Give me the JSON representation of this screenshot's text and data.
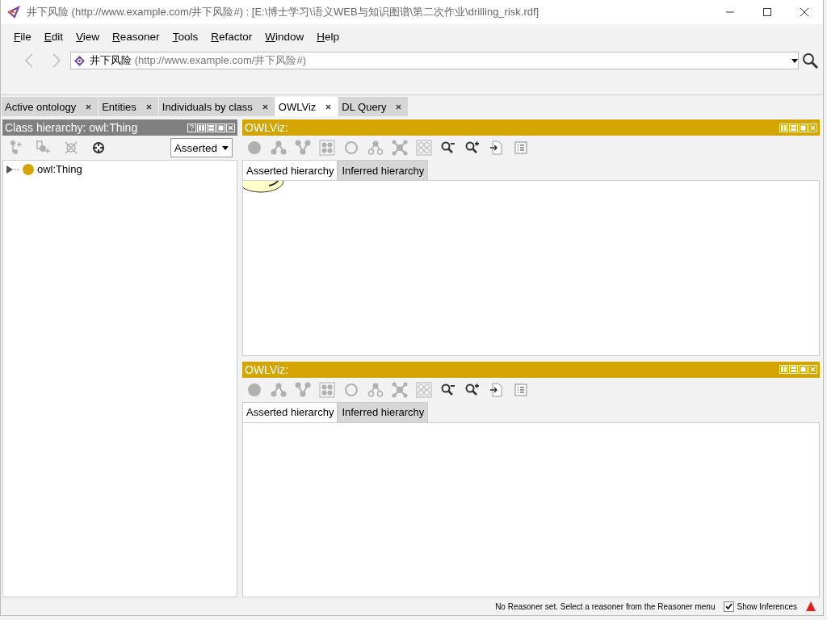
{
  "window": {
    "title": "井下风险 (http://www.example.com/井下风险#)  : [E:\\博士学习\\语义WEB与知识图谱\\第二次作业\\drilling_risk.rdf]"
  },
  "menu": [
    {
      "label": "File"
    },
    {
      "label": "Edit"
    },
    {
      "label": "View"
    },
    {
      "label": "Reasoner"
    },
    {
      "label": "Tools"
    },
    {
      "label": "Refactor"
    },
    {
      "label": "Window"
    },
    {
      "label": "Help"
    }
  ],
  "address": {
    "name": "井下风险",
    "iri": "(http://www.example.com/井下风险#)"
  },
  "tabs": [
    {
      "label": "Active ontology",
      "selected": false
    },
    {
      "label": "Entities",
      "selected": false
    },
    {
      "label": "Individuals by class",
      "selected": false
    },
    {
      "label": "OWLViz",
      "selected": true
    },
    {
      "label": "DL Query",
      "selected": false
    }
  ],
  "class_panel": {
    "title": "Class hierarchy: owl:Thing",
    "header_buttons": [
      {
        "kind": "help"
      },
      {
        "kind": "split-v"
      },
      {
        "kind": "split-h"
      },
      {
        "kind": "max"
      },
      {
        "kind": "close"
      }
    ],
    "toolbar": [
      {
        "kind": "add-sub",
        "disabled": true
      },
      {
        "kind": "add-sib",
        "disabled": true
      },
      {
        "kind": "delete",
        "disabled": true
      },
      {
        "kind": "target",
        "disabled": false
      }
    ],
    "view_select": "Asserted",
    "tree": [
      {
        "label": "owl:Thing",
        "expanded": false
      }
    ]
  },
  "viz_panels": [
    {
      "title": "OWLViz:",
      "header_buttons": [
        {
          "kind": "split-v"
        },
        {
          "kind": "split-h"
        },
        {
          "kind": "max"
        },
        {
          "kind": "close"
        }
      ],
      "toolbar": [
        {
          "kind": "dot",
          "disabled": true
        },
        {
          "kind": "tree-down",
          "disabled": true
        },
        {
          "kind": "tree-up",
          "disabled": true
        },
        {
          "kind": "grid",
          "disabled": true
        },
        {
          "kind": "ring",
          "disabled": true
        },
        {
          "kind": "tree-rings",
          "disabled": true
        },
        {
          "kind": "cluster",
          "disabled": true
        },
        {
          "kind": "grid-rings",
          "disabled": true
        },
        {
          "kind": "zoom-out",
          "disabled": false
        },
        {
          "kind": "zoom-in",
          "disabled": false
        },
        {
          "kind": "export",
          "disabled": false
        },
        {
          "kind": "list",
          "disabled": false
        }
      ],
      "tabs": [
        {
          "label": "Asserted hierarchy",
          "selected": true
        },
        {
          "label": "Inferred hierarchy",
          "selected": false
        }
      ],
      "shows_node": true
    },
    {
      "title": "OWLViz:",
      "header_buttons": [
        {
          "kind": "split-v"
        },
        {
          "kind": "split-h"
        },
        {
          "kind": "max"
        },
        {
          "kind": "close"
        }
      ],
      "toolbar": [
        {
          "kind": "dot",
          "disabled": true
        },
        {
          "kind": "tree-down",
          "disabled": true
        },
        {
          "kind": "tree-up",
          "disabled": true
        },
        {
          "kind": "grid",
          "disabled": true
        },
        {
          "kind": "ring",
          "disabled": true
        },
        {
          "kind": "tree-rings",
          "disabled": true
        },
        {
          "kind": "cluster",
          "disabled": true
        },
        {
          "kind": "grid-rings",
          "disabled": true
        },
        {
          "kind": "zoom-out",
          "disabled": false
        },
        {
          "kind": "zoom-in",
          "disabled": false
        },
        {
          "kind": "export",
          "disabled": false
        },
        {
          "kind": "list",
          "disabled": false
        }
      ],
      "tabs": [
        {
          "label": "Asserted hierarchy",
          "selected": true
        },
        {
          "label": "Inferred hierarchy",
          "selected": false
        }
      ],
      "shows_node": false
    }
  ],
  "status": {
    "message": "No Reasoner set. Select a reasoner from the Reasoner menu",
    "inferences": {
      "label": "Show Inferences",
      "checked": true
    }
  }
}
